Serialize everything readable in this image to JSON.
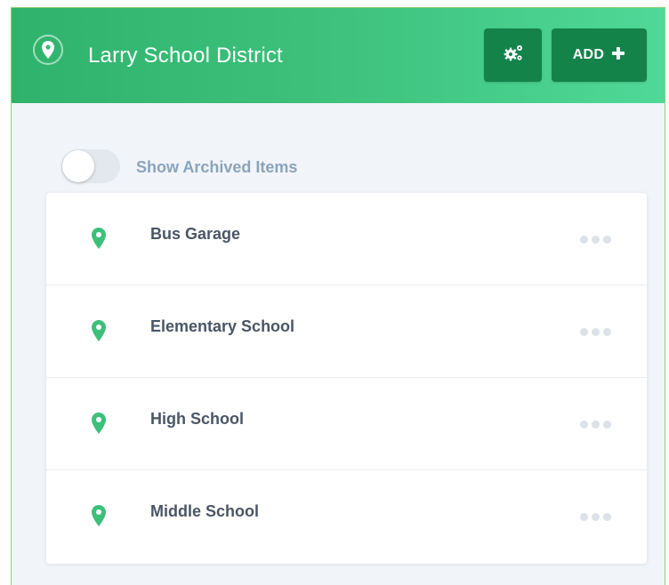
{
  "header": {
    "title": "Larry School District",
    "add_label": "ADD",
    "settings_icon": "gears-icon",
    "add_icon": "plus-icon",
    "location_icon": "map-pin-icon"
  },
  "archive_toggle": {
    "label": "Show Archived Items",
    "on": false
  },
  "locations": [
    {
      "label": "Bus Garage"
    },
    {
      "label": "Elementary School"
    },
    {
      "label": "High School"
    },
    {
      "label": "Middle School"
    }
  ],
  "colors": {
    "header_start": "#2fb36c",
    "header_end": "#4fd898",
    "button_bg": "#13834a",
    "pin": "#3cc07a",
    "item_text": "#4a5566",
    "toggle_label": "#8ba3bd"
  }
}
